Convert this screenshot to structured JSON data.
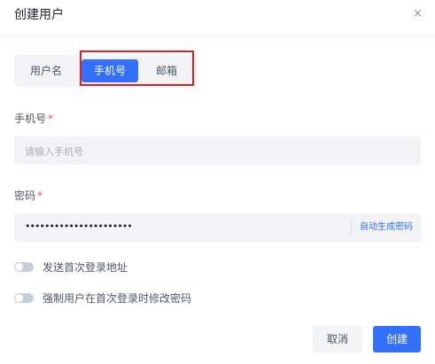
{
  "dialog": {
    "title": "创建用户",
    "close_icon": "×"
  },
  "tabs": [
    {
      "label": "用户名",
      "active": false
    },
    {
      "label": "手机号",
      "active": true
    },
    {
      "label": "邮箱",
      "active": false
    }
  ],
  "phone_field": {
    "label": "手机号",
    "required_mark": "*",
    "placeholder": "请输入手机号"
  },
  "password_field": {
    "label": "密码",
    "required_mark": "*",
    "value": "••••••••••••••••••••••",
    "generate_label": "自动生成密码"
  },
  "options": [
    {
      "label": "发送首次登录地址",
      "checked": false
    },
    {
      "label": "强制用户在首次登录时修改密码",
      "checked": false
    }
  ],
  "footer": {
    "cancel_label": "取消",
    "create_label": "创建"
  },
  "colors": {
    "primary": "#3370ff",
    "highlight_border": "#e02020",
    "required": "#f54a45"
  }
}
